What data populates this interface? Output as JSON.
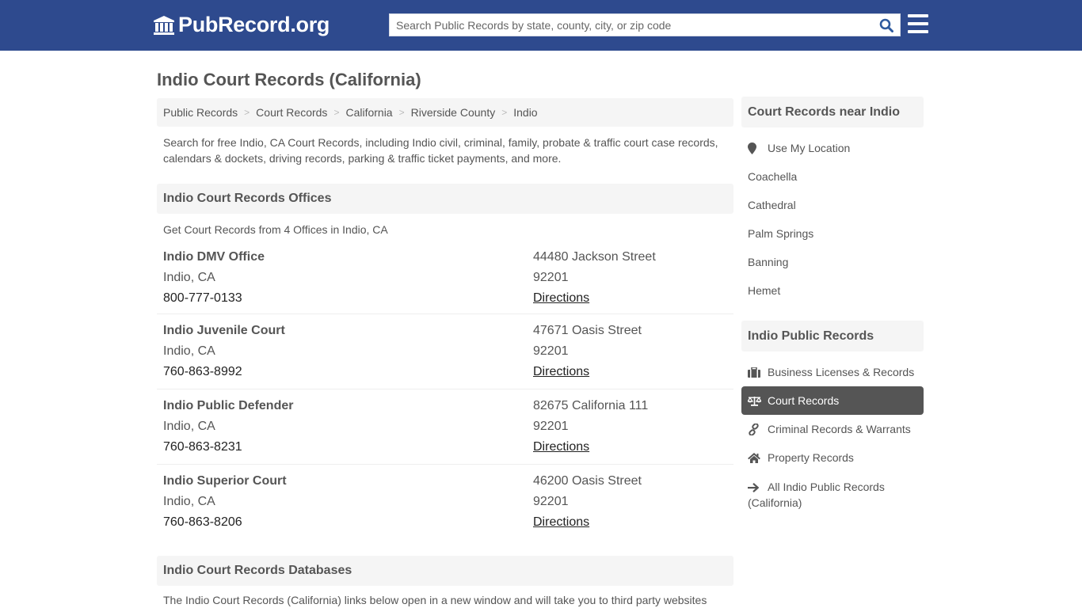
{
  "header": {
    "logo_text": "PubRecord.org",
    "logo_icon": "courthouse-icon",
    "search_placeholder": "Search Public Records by state, county, city, or zip code",
    "search_value": "",
    "search_icon": "search-icon",
    "menu_icon": "hamburger-menu-icon",
    "brand_color": "#2e4a8e"
  },
  "page": {
    "title": "Indio Court Records (California)"
  },
  "breadcrumb": [
    {
      "label": "Public Records"
    },
    {
      "label": "Court Records"
    },
    {
      "label": "California"
    },
    {
      "label": "Riverside County"
    },
    {
      "label": "Indio"
    }
  ],
  "intro": "Search for free Indio, CA Court Records, including Indio civil, criminal, family, probate & traffic court case records, calendars & dockets, driving records, parking & traffic ticket payments, and more.",
  "offices": {
    "heading": "Indio Court Records Offices",
    "subheading": "Get Court Records from 4 Offices in Indio, CA",
    "items": [
      {
        "name": "Indio DMV Office",
        "city": "Indio, CA",
        "phone": "800-777-0133",
        "street": "44480 Jackson Street",
        "zip": "92201",
        "directions": "Directions"
      },
      {
        "name": "Indio Juvenile Court",
        "city": "Indio, CA",
        "phone": "760-863-8992",
        "street": "47671 Oasis Street",
        "zip": "92201",
        "directions": "Directions"
      },
      {
        "name": "Indio Public Defender",
        "city": "Indio, CA",
        "phone": "760-863-8231",
        "street": "82675 California 111",
        "zip": "92201",
        "directions": "Directions"
      },
      {
        "name": "Indio Superior Court",
        "city": "Indio, CA",
        "phone": "760-863-8206",
        "street": "46200 Oasis Street",
        "zip": "92201",
        "directions": "Directions"
      }
    ]
  },
  "databases": {
    "heading": "Indio Court Records Databases",
    "text": "The Indio Court Records (California) links below open in a new window and will take you to third party websites"
  },
  "sidebar": {
    "nearby": {
      "heading": "Court Records near Indio",
      "use_location": "Use My Location",
      "location_icon": "map-marker-icon",
      "cities": [
        "Coachella",
        "Cathedral",
        "Palm Springs",
        "Banning",
        "Hemet"
      ]
    },
    "public_records": {
      "heading": "Indio Public Records",
      "items": [
        {
          "label": "Business Licenses & Records",
          "icon": "briefcase-icon",
          "active": false
        },
        {
          "label": "Court Records",
          "icon": "balance-scale-icon",
          "active": true
        },
        {
          "label": "Criminal Records & Warrants",
          "icon": "link-icon",
          "active": false
        },
        {
          "label": "Property Records",
          "icon": "home-icon",
          "active": false
        },
        {
          "label": "All Indio Public Records (California)",
          "icon": "arrow-right-icon",
          "active": false
        }
      ]
    }
  }
}
